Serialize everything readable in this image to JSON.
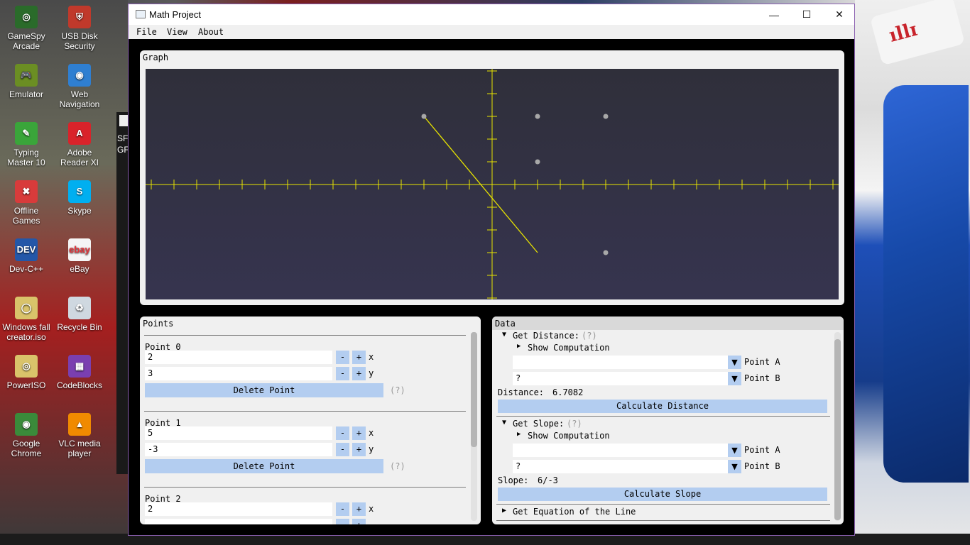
{
  "desktop": {
    "icons": [
      {
        "label": "GameSpy Arcade",
        "icon": "gamespy-icon",
        "color": "#2a6b2a"
      },
      {
        "label": "USB Disk Security",
        "icon": "usb-shield-icon",
        "color": "#c0392b"
      },
      {
        "label": "Emulator",
        "icon": "gamepad-icon",
        "color": "#6b8e23"
      },
      {
        "label": "Web Navigation",
        "icon": "globe-icon",
        "color": "#2f7fd1"
      },
      {
        "label": "Typing Master 10",
        "icon": "typing-master-icon",
        "color": "#3aa53a"
      },
      {
        "label": "Adobe Reader XI",
        "icon": "pdf-icon",
        "color": "#d9232a"
      },
      {
        "label": "Offline Games",
        "icon": "games-icon",
        "color": "#d83b3b"
      },
      {
        "label": "Skype",
        "icon": "skype-icon",
        "color": "#00aff0"
      },
      {
        "label": "Dev-C++",
        "icon": "devcpp-icon",
        "color": "#2457a8"
      },
      {
        "label": "eBay",
        "icon": "ebay-icon",
        "color": "#f5f5f5"
      },
      {
        "label": "Windows fall creator.iso",
        "icon": "disc-icon",
        "color": "#d9c36a"
      },
      {
        "label": "Recycle Bin",
        "icon": "recycle-bin-icon",
        "color": "#cfd8e0"
      },
      {
        "label": "PowerISO",
        "icon": "poweriso-icon",
        "color": "#d9c36a"
      },
      {
        "label": "CodeBlocks",
        "icon": "codeblocks-icon",
        "color": "#7a3fb0"
      },
      {
        "label": "Google Chrome",
        "icon": "chrome-icon",
        "color": "#3a8a3a"
      },
      {
        "label": "VLC media player",
        "icon": "vlc-icon",
        "color": "#f08a00"
      }
    ],
    "icon_glyphs": [
      "◎",
      "⛨",
      "🎮",
      "◉",
      "✎",
      "A",
      "✖",
      "S",
      "DEV",
      "ebay",
      "◯",
      "♻",
      "◎",
      "▦",
      "◉",
      "▲"
    ],
    "partial_label_1": "SF",
    "partial_label_2": "GF"
  },
  "window": {
    "title": "Math Project",
    "controls": {
      "minimize": "—",
      "maximize": "☐",
      "close": "✕"
    },
    "menu": [
      "File",
      "View",
      "About"
    ]
  },
  "graph": {
    "title": "Graph",
    "background": "#333245",
    "axis_color": "#e8e400",
    "points": [
      {
        "x": 2,
        "y": 3
      },
      {
        "x": 5,
        "y": -3
      },
      {
        "x": 2,
        "y": 1
      },
      {
        "x": 5,
        "y": 3
      },
      {
        "x": -3,
        "y": 3
      }
    ],
    "segment": {
      "from": {
        "x": -3,
        "y": 3
      },
      "to": {
        "x": 2,
        "y": -3
      }
    },
    "x_range": [
      -15,
      15
    ],
    "y_range": [
      -5,
      5
    ]
  },
  "points_panel": {
    "title": "Points",
    "items": [
      {
        "label": "Point 0",
        "x": "2",
        "y": "3"
      },
      {
        "label": "Point 1",
        "x": "5",
        "y": "-3"
      },
      {
        "label": "Point 2",
        "x": "2",
        "y": ""
      }
    ],
    "minus": "-",
    "plus": "+",
    "x_label": "x",
    "y_label": "y",
    "delete_label": "Delete Point",
    "help": "(?)"
  },
  "data_panel": {
    "title": "Data",
    "distance": {
      "header": "Get Distance:",
      "help": "(?)",
      "show_computation": "Show Computation",
      "point_a_value": "",
      "point_b_value": "?",
      "point_a_label": "Point A",
      "point_b_label": "Point B",
      "result_label": "Distance:",
      "result_value": "6.7082",
      "button": "Calculate Distance"
    },
    "slope": {
      "header": "Get Slope:",
      "help": "(?)",
      "show_computation": "Show Computation",
      "point_a_value": "",
      "point_b_value": "?",
      "point_a_label": "Point A",
      "point_b_label": "Point B",
      "result_label": "Slope:",
      "result_value": "6/-3",
      "button": "Calculate Slope"
    },
    "equation": {
      "header": "Get Equation of the Line"
    },
    "expanded_arrow": "▼",
    "collapsed_arrow": "▶",
    "dropdown_arrow": "▼"
  }
}
